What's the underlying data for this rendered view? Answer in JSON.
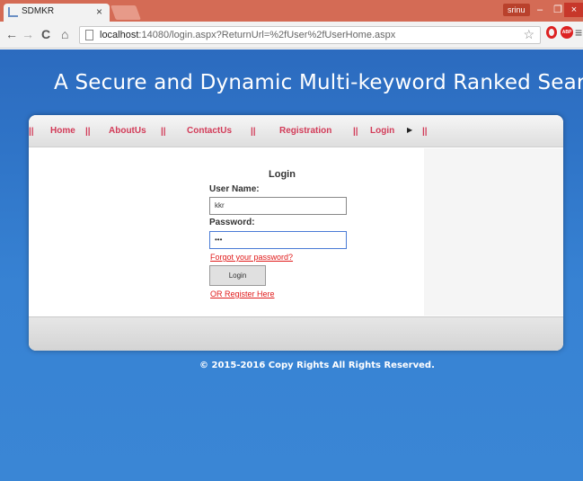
{
  "browser": {
    "tab_title": "SDMKR",
    "tab_close": "×",
    "user_badge": "srinu",
    "minimize": "–",
    "maximize": "❐",
    "close": "×",
    "url_host": "localhost",
    "url_rest": ":14080/login.aspx?ReturnUrl=%2fUser%2fUserHome.aspx",
    "back": "←",
    "forward": "→",
    "reload": "C",
    "home": "⌂",
    "star": "☆",
    "abp": "ABP",
    "menu": "≡"
  },
  "header": {
    "title": "A Secure and Dynamic Multi-keyword Ranked Search"
  },
  "nav": {
    "separator": "||",
    "items": [
      "Home",
      "AboutUs",
      "ContactUs",
      "Registration",
      "Login"
    ],
    "arrow": "▶"
  },
  "login": {
    "heading": "Login",
    "username_label": "User Name:",
    "username_value": "kkr",
    "password_label": "Password:",
    "password_value": "•••",
    "forgot_link": "Forgot your password?",
    "login_button": "Login",
    "register_link": "OR Register Here"
  },
  "footer": {
    "copyright": "© 2015-2016 Copy Rights All Rights Reserved."
  },
  "colors": {
    "titlebar": "#d46b55",
    "page_blue": "#2f74c7",
    "nav_link": "#d23b58",
    "link_red": "#e01a1a"
  }
}
